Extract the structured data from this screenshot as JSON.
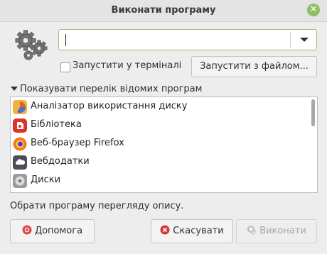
{
  "window": {
    "title": "Виконати програму"
  },
  "icons": {
    "close": "close-icon",
    "gears": "gears-icon",
    "dropdown": "chevron-down-icon"
  },
  "command": {
    "value": ""
  },
  "options": {
    "run_in_terminal": "Запустити у терміналі",
    "run_with_file": "Запустити з файлом..."
  },
  "app_list": {
    "toggle_label": "Показувати перелік відомих програм",
    "items": [
      {
        "label": "Аналізатор використання диску",
        "icon": "disk-usage-analyzer-icon",
        "color": "#e95e22"
      },
      {
        "label": "Бібліотека",
        "icon": "library-icon",
        "color": "#d9362b"
      },
      {
        "label": "Веб-браузер Firefox",
        "icon": "firefox-icon",
        "color": "#f27a1f"
      },
      {
        "label": "Вебдодатки",
        "icon": "webapps-icon",
        "color": "#4a4f55"
      },
      {
        "label": "Диски",
        "icon": "disks-icon",
        "color": "#8a8a8a"
      }
    ]
  },
  "status_text": "Обрати програму перегляду опису.",
  "buttons": {
    "help": "Допомога",
    "cancel": "Скасувати",
    "run": "Виконати"
  },
  "colors": {
    "accent": "#8fbf60",
    "cancel_icon": "#d33a3a",
    "help_icon": "#e14a4a"
  }
}
